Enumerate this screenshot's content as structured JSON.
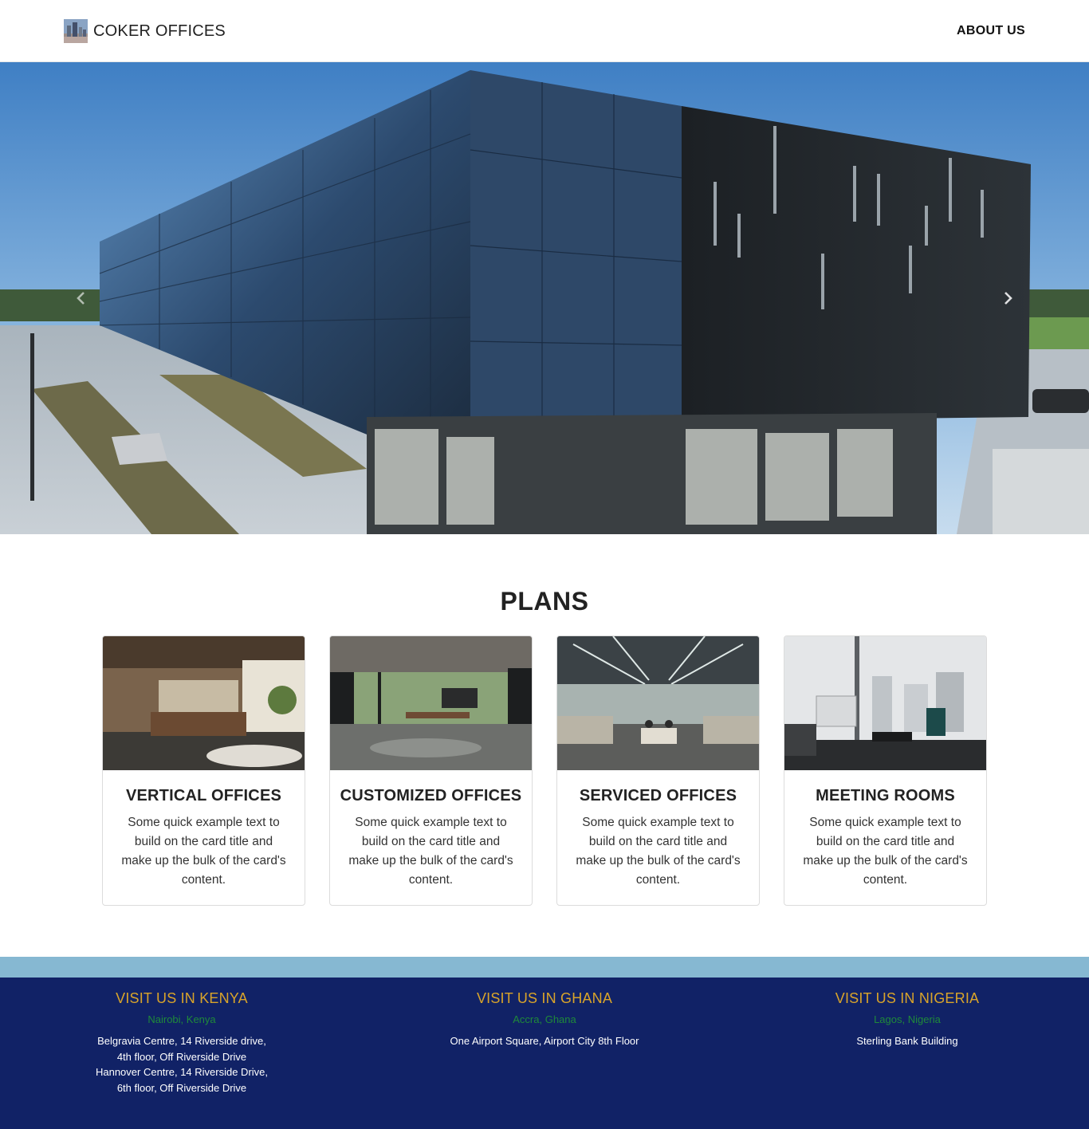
{
  "navbar": {
    "brand": "COKER OFFICES",
    "logo_icon": "building-logo-icon",
    "links": [
      {
        "label": "ABOUT US"
      }
    ]
  },
  "hero": {
    "prev_icon": "chevron-left-icon",
    "next_icon": "chevron-right-icon"
  },
  "plans": {
    "title": "PLANS",
    "cards": [
      {
        "title": "VERTICAL OFFICES",
        "text": "Some quick example text to build on the card title and make up the bulk of the card's content."
      },
      {
        "title": "CUSTOMIZED OFFICES",
        "text": "Some quick example text to build on the card title and make up the bulk of the card's content."
      },
      {
        "title": "SERVICED OFFICES",
        "text": "Some quick example text to build on the card title and make up the bulk of the card's content."
      },
      {
        "title": "MEETING ROOMS",
        "text": "Some quick example text to build on the card title and make up the bulk of the card's content."
      }
    ]
  },
  "footer": {
    "locations": [
      {
        "heading": "VISIT US IN KENYA",
        "city": "Nairobi, Kenya",
        "address": "Belgravia Centre, 14 Riverside drive,\n4th floor, Off Riverside Drive\nHannover Centre, 14 Riverside Drive,\n6th floor, Off Riverside Drive"
      },
      {
        "heading": "VISIT US IN GHANA",
        "city": "Accra, Ghana",
        "address": "One Airport Square, Airport City 8th Floor"
      },
      {
        "heading": "VISIT US IN NIGERIA",
        "city": "Lagos, Nigeria",
        "address": "Sterling Bank Building"
      }
    ]
  },
  "colors": {
    "footer_bg": "#112266",
    "footer_band": "#86b8d2",
    "footer_heading": "#d9a42a",
    "footer_city": "#1f8a3a"
  }
}
